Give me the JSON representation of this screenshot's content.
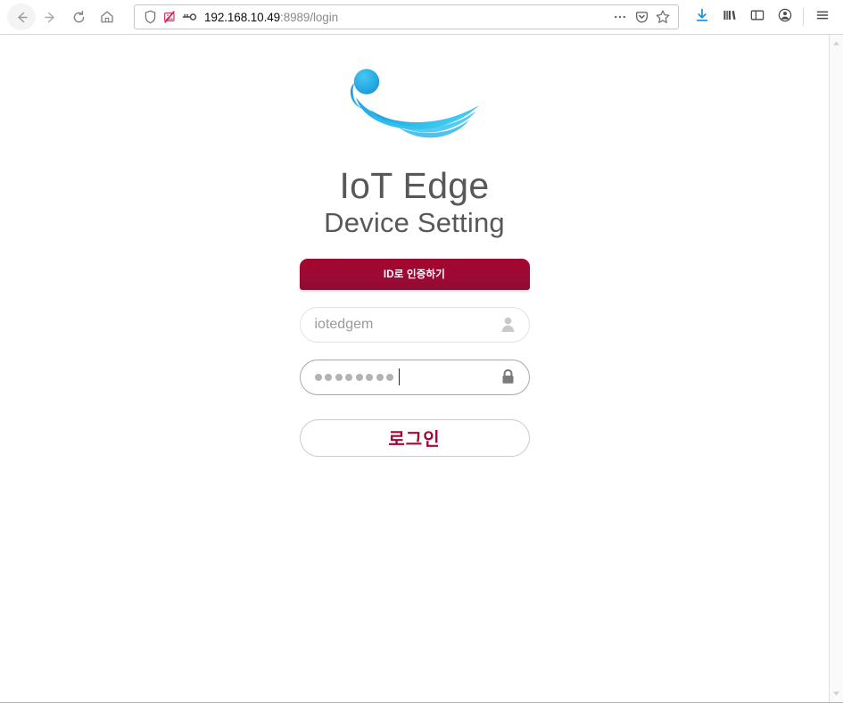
{
  "browser": {
    "nav": {
      "back_label": "Back",
      "forward_label": "Forward",
      "reload_label": "Reload",
      "home_label": "Home"
    },
    "urlbar": {
      "host": "192.168.10.49",
      "rest": ":8989/login",
      "full_url": "192.168.10.49:8989/login",
      "shield_icon": "shield-icon",
      "tracker_blocked_icon": "tracking-protection-blocked-icon",
      "key_icon": "saved-login-key-icon",
      "page_actions_icon": "ellipsis-icon",
      "pocket_icon": "pocket-icon",
      "bookmark_icon": "star-icon"
    },
    "toolbar_right": {
      "downloads_icon": "download-arrow-icon",
      "library_icon": "library-icon",
      "sidebar_icon": "sidebar-icon",
      "account_icon": "account-avatar-icon",
      "menu_icon": "hamburger-menu-icon"
    },
    "scrollbar": {
      "up_arrow": "scroll-up-arrow-icon",
      "down_arrow": "scroll-down-arrow-icon"
    }
  },
  "page": {
    "logo_name": "iot-edge-wave-logo",
    "title": "IoT Edge",
    "subtitle": "Device Setting",
    "auth_tab_label": "ID로 인증하기",
    "username": {
      "value": "iotedgem",
      "placeholder": "iotedgem",
      "icon": "user-icon"
    },
    "password": {
      "masked_length": 8,
      "placeholder": "",
      "icon": "lock-icon"
    },
    "login_button_label": "로그인"
  },
  "colors": {
    "brand_crimson": "#9d0a34",
    "logo_cyan": "#29b6e8",
    "logo_blue": "#1b8fd4",
    "text_gray": "#58585a",
    "field_border": "#e2e2e2",
    "field_border_focused": "#a8a8a8"
  }
}
